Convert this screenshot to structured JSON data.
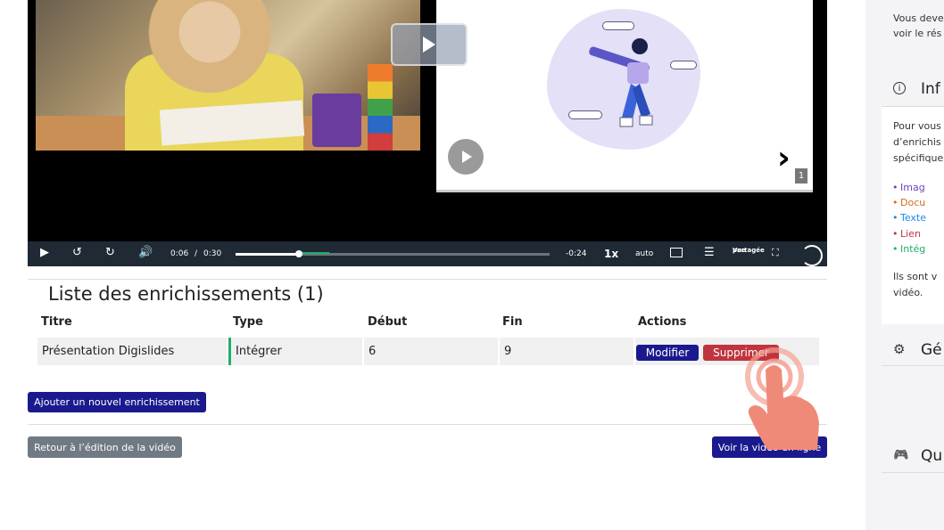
{
  "player": {
    "current_time": "0:06",
    "separator": "/",
    "duration": "0:30",
    "remaining": "-0:24",
    "speed": "1x",
    "quality": "auto",
    "shared_view_label_line1": "Vue",
    "shared_view_label_line2": "partagée",
    "progress_fraction": 0.2,
    "slide_number": "1"
  },
  "enrichments": {
    "title": "Liste des enrichissements (1)",
    "columns": [
      "Titre",
      "Type",
      "Début",
      "Fin",
      "Actions"
    ],
    "rows": [
      {
        "title": "Présentation Digislides",
        "type": "Intégrer",
        "start": "6",
        "end": "9",
        "edit_label": "Modifier",
        "delete_label": "Supprimer"
      }
    ],
    "type_color": "#1fae6b"
  },
  "buttons": {
    "add": "Ajouter un nouvel enrichissement",
    "back": "Retour à l’édition de la vidéo",
    "view": "Voir la vidéo en ligne"
  },
  "sidebar": {
    "notice_line1": "Vous deve",
    "notice_line2": "voir le rés",
    "info_heading": "Inf",
    "info_line1": "Pour vous",
    "info_line2": "d’enrichis",
    "info_line3": "spécifique",
    "types": [
      {
        "label": "Imag",
        "color": "#6f42c1"
      },
      {
        "label": "Docu",
        "color": "#d9671e"
      },
      {
        "label": "Texte",
        "color": "#1e88e5"
      },
      {
        "label": "Lien",
        "color": "#c0343f"
      },
      {
        "label": "Intég",
        "color": "#1fae6b"
      }
    ],
    "after_line1": "Ils sont v",
    "after_line2": "vidéo.",
    "general_heading": "Gé",
    "quiz_heading": "Qu"
  },
  "colors": {
    "primary": "#1a1a8e",
    "danger": "#c0343f",
    "secondary": "#707a83"
  }
}
